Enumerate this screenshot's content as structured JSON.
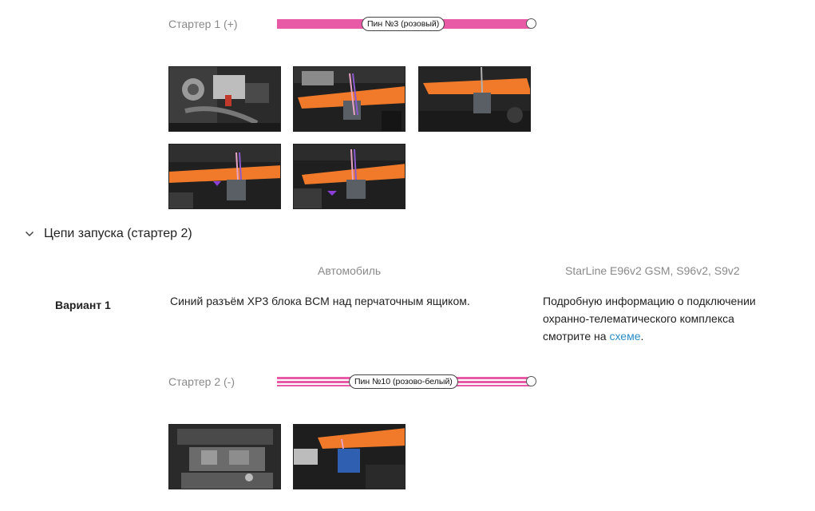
{
  "starter1": {
    "label": "Стартер 1 (+)",
    "pin": "Пин №3 (розовый)",
    "color": "#e85aa6",
    "photos": [
      "photo-engine-bay",
      "photo-connector-orange-tool",
      "photo-connector-orange-tool",
      "photo-connector-pink-wire",
      "photo-connector-pink-wire"
    ]
  },
  "section": {
    "title": "Цепи запуска (стартер 2)",
    "chevron": "chevron-down-icon"
  },
  "columns": {
    "car": "Автомобиль",
    "starline": "StarLine E96v2 GSM, S96v2, S9v2"
  },
  "variant": {
    "label": "Вариант 1",
    "car_text": "Синий разъём XP3 блока BCM над перчаточным ящиком.",
    "info_lines": [
      "Подробную информацию о подключении",
      "охранно-телематического комплекса"
    ],
    "info_prefix": "смотрите на",
    "info_link": "схеме",
    "info_suffix": "."
  },
  "starter2": {
    "label": "Стартер 2 (-)",
    "pin": "Пин №10 (розово-белый)",
    "color": "#e85aa6",
    "photos": [
      "photo-glovebox-area",
      "photo-blue-connector"
    ]
  }
}
